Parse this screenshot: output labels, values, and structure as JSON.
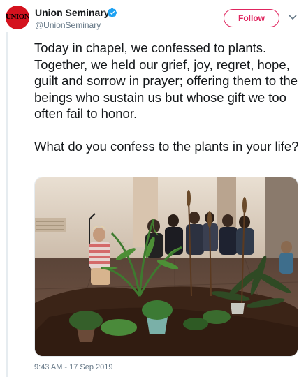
{
  "account": {
    "display_name": "Union Seminary",
    "handle": "@UnionSeminary",
    "avatar_text": "UNION",
    "verified": true
  },
  "actions": {
    "follow_label": "Follow"
  },
  "tweet": {
    "text": "Today in chapel, we confessed to plants. Together, we held our grief, joy, regret, hope, guilt and sorrow in prayer; offering them to the beings who sustain us but whose gift we too often fail to honor.\n\nWhat do you confess to the plants in your life?",
    "timestamp": "9:43 AM - 17 Sep 2019"
  },
  "icons": {
    "verified": "verified-badge-icon",
    "menu": "chevron-down-icon"
  },
  "colors": {
    "brand_red": "#d4121e",
    "follow_accent": "#e0245e",
    "verified_blue": "#1da1f2",
    "muted_text": "#657786"
  }
}
